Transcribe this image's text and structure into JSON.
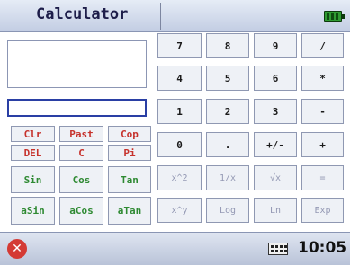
{
  "app": {
    "title": "Calculator"
  },
  "display": {
    "value": ""
  },
  "input": {
    "value": ""
  },
  "left_keys": [
    {
      "label": "Clr",
      "color": "red"
    },
    {
      "label": "Past",
      "color": "red"
    },
    {
      "label": "Cop",
      "color": "red"
    },
    {
      "label": "DEL",
      "color": "red"
    },
    {
      "label": "C",
      "color": "red"
    },
    {
      "label": "Pi",
      "color": "red"
    },
    {
      "label": "Sin",
      "color": "green"
    },
    {
      "label": "Cos",
      "color": "green"
    },
    {
      "label": "Tan",
      "color": "green"
    },
    {
      "label": "aSin",
      "color": "green"
    },
    {
      "label": "aCos",
      "color": "green"
    },
    {
      "label": "aTan",
      "color": "green"
    }
  ],
  "right_keys": [
    {
      "label": "7",
      "color": "dark"
    },
    {
      "label": "8",
      "color": "dark"
    },
    {
      "label": "9",
      "color": "dark"
    },
    {
      "label": "/",
      "color": "dark"
    },
    {
      "label": "4",
      "color": "dark"
    },
    {
      "label": "5",
      "color": "dark"
    },
    {
      "label": "6",
      "color": "dark"
    },
    {
      "label": "*",
      "color": "dark"
    },
    {
      "label": "1",
      "color": "dark"
    },
    {
      "label": "2",
      "color": "dark"
    },
    {
      "label": "3",
      "color": "dark"
    },
    {
      "label": "-",
      "color": "dark"
    },
    {
      "label": "0",
      "color": "dark"
    },
    {
      "label": ".",
      "color": "dark"
    },
    {
      "label": "+/-",
      "color": "dark"
    },
    {
      "label": "+",
      "color": "dark"
    },
    {
      "label": "x^2",
      "color": "gray"
    },
    {
      "label": "1/x",
      "color": "gray"
    },
    {
      "label": "√x",
      "color": "gray"
    },
    {
      "label": "=",
      "color": "gray"
    },
    {
      "label": "x^y",
      "color": "gray"
    },
    {
      "label": "Log",
      "color": "gray"
    },
    {
      "label": "Ln",
      "color": "gray"
    },
    {
      "label": "Exp",
      "color": "gray"
    }
  ],
  "taskbar": {
    "time": "10:05",
    "close_icon": "close-icon",
    "keyboard_icon": "keyboard-icon",
    "battery_icon": "battery-icon"
  },
  "colors": {
    "red": "#c6322c",
    "green": "#2f8a33",
    "dark": "#1b1b1b",
    "gray": "#9499b4",
    "accent": "#2a3fa4"
  }
}
